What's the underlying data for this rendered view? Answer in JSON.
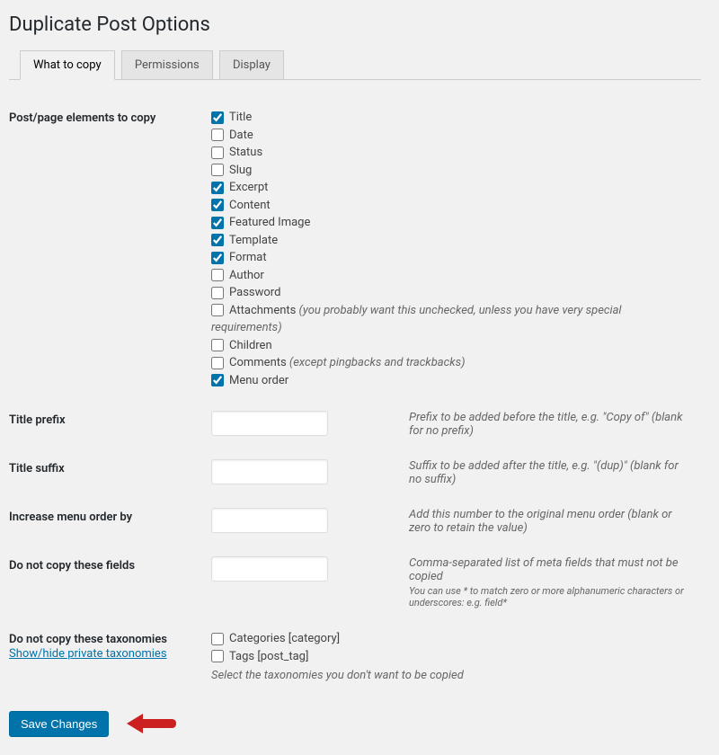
{
  "page_title": "Duplicate Post Options",
  "tabs": [
    {
      "label": "What to copy",
      "active": true
    },
    {
      "label": "Permissions",
      "active": false
    },
    {
      "label": "Display",
      "active": false
    }
  ],
  "elements_label": "Post/page elements to copy",
  "elements": [
    {
      "label": "Title",
      "checked": true,
      "hint": ""
    },
    {
      "label": "Date",
      "checked": false,
      "hint": ""
    },
    {
      "label": "Status",
      "checked": false,
      "hint": ""
    },
    {
      "label": "Slug",
      "checked": false,
      "hint": ""
    },
    {
      "label": "Excerpt",
      "checked": true,
      "hint": ""
    },
    {
      "label": "Content",
      "checked": true,
      "hint": ""
    },
    {
      "label": "Featured Image",
      "checked": true,
      "hint": ""
    },
    {
      "label": "Template",
      "checked": true,
      "hint": ""
    },
    {
      "label": "Format",
      "checked": true,
      "hint": ""
    },
    {
      "label": "Author",
      "checked": false,
      "hint": ""
    },
    {
      "label": "Password",
      "checked": false,
      "hint": ""
    },
    {
      "label": "Attachments",
      "checked": false,
      "hint": "(you probably want this unchecked, unless you have very special requirements)"
    },
    {
      "label": "Children",
      "checked": false,
      "hint": ""
    },
    {
      "label": "Comments",
      "checked": false,
      "hint": "(except pingbacks and trackbacks)"
    },
    {
      "label": "Menu order",
      "checked": true,
      "hint": ""
    }
  ],
  "fields": {
    "title_prefix": {
      "label": "Title prefix",
      "value": "",
      "desc": "Prefix to be added before the title, e.g. \"Copy of\" (blank for no prefix)"
    },
    "title_suffix": {
      "label": "Title suffix",
      "value": "",
      "desc": "Suffix to be added after the title, e.g. \"(dup)\" (blank for no suffix)"
    },
    "menu_order": {
      "label": "Increase menu order by",
      "value": "",
      "desc": "Add this number to the original menu order (blank or zero to retain the value)"
    },
    "no_copy_fields": {
      "label": "Do not copy these fields",
      "value": "",
      "desc": "Comma-separated list of meta fields that must not be copied",
      "desc2": "You can use * to match zero or more alphanumeric characters or underscores: e.g. field*"
    }
  },
  "taxonomies": {
    "label": "Do not copy these taxonomies",
    "toggle": "Show/hide private taxonomies",
    "items": [
      {
        "label": "Categories [category]",
        "checked": false
      },
      {
        "label": "Tags [post_tag]",
        "checked": false
      }
    ],
    "desc": "Select the taxonomies you don't want to be copied"
  },
  "save_button": "Save Changes"
}
